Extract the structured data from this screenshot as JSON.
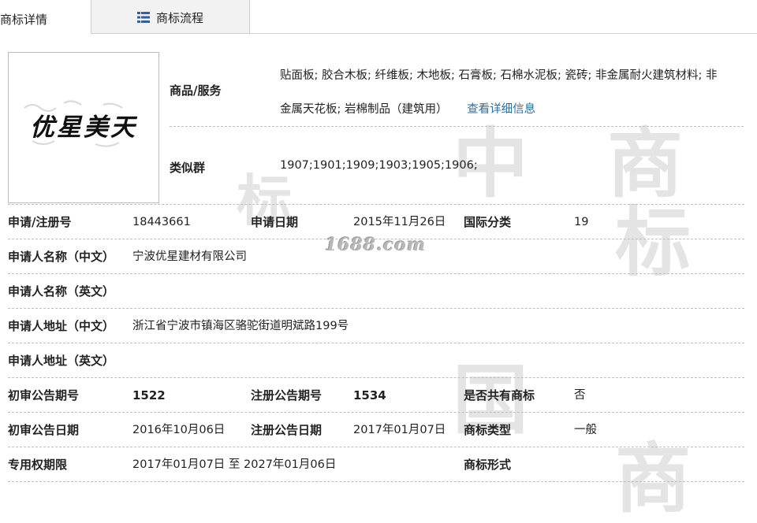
{
  "tabs": [
    {
      "label": "商标详情"
    },
    {
      "label": "商标流程"
    }
  ],
  "watermark": {
    "glyph1": "中",
    "glyph2": "国",
    "glyph3": "商",
    "glyph4": "标",
    "site": "1688.com"
  },
  "logo": {
    "text": "优星美天"
  },
  "goods": {
    "label": "商品/服务",
    "line1": "贴面板; 胶合木板; 纤维板; 木地板; 石膏板; 石棉水泥板; 瓷砖; 非金属耐火建筑材料; 非",
    "line2": "金属天花板; 岩棉制品（建筑用）",
    "link": "查看详细信息"
  },
  "similar": {
    "label": "类似群",
    "value": "1907;1901;1909;1903;1905;1906;"
  },
  "rows": {
    "reg_no_label": "申请/注册号",
    "reg_no": "18443661",
    "app_date_label": "申请日期",
    "app_date": "2015年11月26日",
    "intl_class_label": "国际分类",
    "intl_class": "19",
    "name_cn_label": "申请人名称（中文）",
    "name_cn": "宁波优星建材有限公司",
    "name_en_label": "申请人名称（英文）",
    "name_en": "",
    "addr_cn_label": "申请人地址（中文）",
    "addr_cn": "浙江省宁波市镇海区骆驼街道明斌路199号",
    "addr_en_label": "申请人地址（英文）",
    "addr_en": "",
    "prelim_no_label": "初审公告期号",
    "prelim_no": "1522",
    "reg_pub_no_label": "注册公告期号",
    "reg_pub_no": "1534",
    "shared_label": "是否共有商标",
    "shared": "否",
    "prelim_date_label": "初审公告日期",
    "prelim_date": "2016年10月06日",
    "reg_pub_date_label": "注册公告日期",
    "reg_pub_date": "2017年01月07日",
    "type_label": "商标类型",
    "type": "一般",
    "term_label": "专用权期限",
    "term": "2017年01月07日 至 2027年01月06日",
    "form_label": "商标形式",
    "form": ""
  }
}
